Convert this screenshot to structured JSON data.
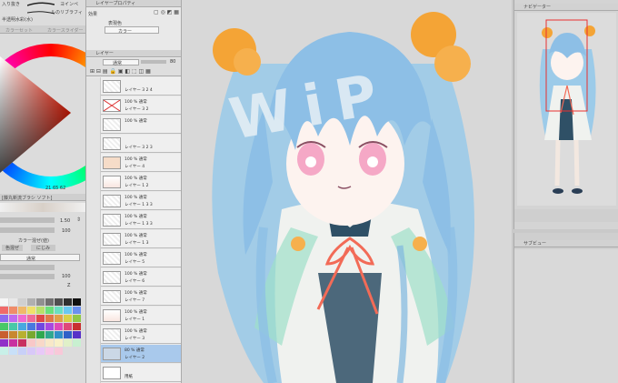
{
  "left_top": {
    "labels": [
      "入り抜き",
      "ヨインペ",
      "ルのリブラフィ",
      "半透明水彩(水)"
    ],
    "tabs": [
      "カラーセット",
      "カラースライダー"
    ]
  },
  "color_wheel": {
    "coords": "21  65  62"
  },
  "brush": {
    "title": "[藤丸新流ブラシ ソフト]",
    "size": "1.50",
    "density": "100",
    "section": "カラー混ぜ(値)",
    "mode": "通常",
    "opacity": "100",
    "min": "100",
    "btn_left": "色混ぜ",
    "btn_right": "にじみ",
    "mix_mode": "通常",
    "z": "Z"
  },
  "palette": {
    "colors": [
      "#f5f5f5",
      "#e8e8e8",
      "#d0d0d0",
      "#b0b0b0",
      "#909090",
      "#707070",
      "#505050",
      "#303030",
      "#101010",
      "#f06a6a",
      "#f08c6a",
      "#f0b86a",
      "#f0e06a",
      "#b8e06a",
      "#6ae07a",
      "#6ae0c0",
      "#6ac8f0",
      "#6a90f0",
      "#8c6af0",
      "#c06af0",
      "#f06ad0",
      "#f06a98",
      "#e04848",
      "#e07848",
      "#e0a048",
      "#d8d048",
      "#90c848",
      "#48c868",
      "#48c8a8",
      "#48a8e0",
      "#4878e0",
      "#7048e0",
      "#a848e0",
      "#e048b8",
      "#e04878",
      "#c83030",
      "#c86030",
      "#c88830",
      "#b8b030",
      "#78a830",
      "#30a850",
      "#30a890",
      "#3090c8",
      "#3060c8",
      "#5830c8",
      "#9030c8",
      "#c830a0",
      "#c83060",
      "#f8c8c8",
      "#f8d8c8",
      "#f8e8c8",
      "#f8f0c8",
      "#e0f0c8",
      "#c8f0d0",
      "#c8f0e8",
      "#c8e0f8",
      "#c8d0f8",
      "#d8c8f8",
      "#e8c8f8",
      "#f8c8e8",
      "#f8c8d8"
    ]
  },
  "layer_prop": {
    "title": "レイヤープロパティ",
    "effect": "効果",
    "expr_color": "表現色",
    "color_value": "カラー"
  },
  "layer_panel": {
    "title": "レイヤー",
    "blend": "通常",
    "opacity": "80",
    "layers": [
      {
        "pct": "",
        "name": "レイヤー 3 2 4",
        "kind": "plain"
      },
      {
        "pct": "100 % 通常",
        "name": "レイヤー 3 2",
        "kind": "cross"
      },
      {
        "pct": "100 % 通常",
        "name": "",
        "kind": "plain"
      },
      {
        "pct": "",
        "name": "レイヤー 3 2 3",
        "kind": "plain"
      },
      {
        "pct": "100 % 通常",
        "name": "レイヤー 4",
        "kind": "sketch"
      },
      {
        "pct": "100 % 通常",
        "name": "レイヤー 1 2",
        "kind": "figure"
      },
      {
        "pct": "100 % 通常",
        "name": "レイヤー 1 3 3",
        "kind": "plain"
      },
      {
        "pct": "100 % 通常",
        "name": "レイヤー 1 3 3",
        "kind": "plain"
      },
      {
        "pct": "100 % 通常",
        "name": "レイヤー 1 3",
        "kind": "plain"
      },
      {
        "pct": "100 % 通常",
        "name": "レイヤー 5",
        "kind": "plain"
      },
      {
        "pct": "100 % 通常",
        "name": "レイヤー 6",
        "kind": "plain"
      },
      {
        "pct": "100 % 通常",
        "name": "レイヤー 7",
        "kind": "plain"
      },
      {
        "pct": "100 % 通常",
        "name": "レイヤー 1",
        "kind": "figure"
      },
      {
        "pct": "100 % 通常",
        "name": "レイヤー 3",
        "kind": "plain"
      },
      {
        "pct": "80 % 通常",
        "name": "レイヤー 2",
        "kind": "selected"
      },
      {
        "pct": "",
        "name": "用紙",
        "kind": "paper"
      }
    ]
  },
  "canvas": {
    "watermark": "WiP"
  },
  "navigator": {
    "title": "ナビゲーター"
  },
  "subview": {
    "title": "サブビュー"
  },
  "colors": {
    "accent": "#a9c9ec",
    "hair": "#8dbfe6",
    "bun": "#f4a436"
  }
}
